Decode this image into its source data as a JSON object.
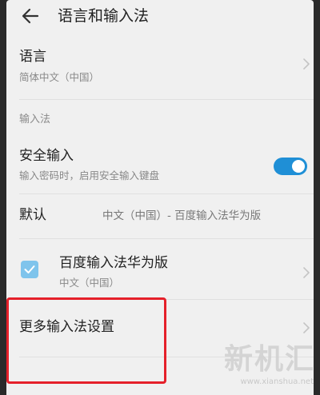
{
  "header": {
    "back_icon": "arrow-left-icon",
    "title": "语言和输入法"
  },
  "language": {
    "title": "语言",
    "value": "简体中文（中国）"
  },
  "section_input": {
    "label": "输入法"
  },
  "secure_input": {
    "title": "安全输入",
    "subtitle": "输入密码时，启用安全输入键盘",
    "enabled": true
  },
  "default_input": {
    "title": "默认",
    "value": "中文（中国）- 百度输入法华为版"
  },
  "baidu_ime": {
    "checked": true,
    "title": "百度输入法华为版",
    "subtitle": "中文（中国）"
  },
  "more_settings": {
    "title": "更多输入法设置"
  },
  "watermark": {
    "text": "新机汇",
    "url": "www.xianshua.net"
  },
  "colors": {
    "accent": "#1f8fd6",
    "highlight": "#e5202a"
  }
}
